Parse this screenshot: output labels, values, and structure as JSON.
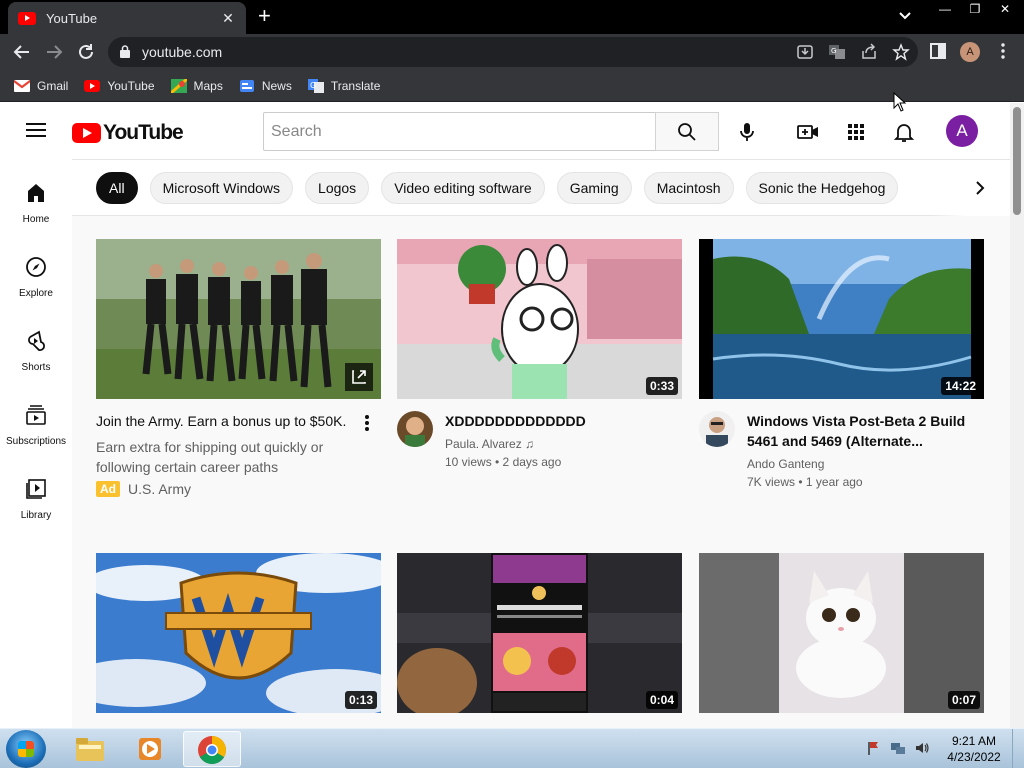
{
  "browser": {
    "tab_title": "YouTube",
    "tab_close": "✕",
    "new_tab": "+",
    "url": "youtube.com",
    "profile_initial": "A",
    "window_controls": [
      "—",
      "❐",
      "✕"
    ],
    "bookmarks": [
      {
        "label": "Gmail",
        "icon": "gmail-icon"
      },
      {
        "label": "YouTube",
        "icon": "youtube-icon"
      },
      {
        "label": "Maps",
        "icon": "maps-icon"
      },
      {
        "label": "News",
        "icon": "news-icon"
      },
      {
        "label": "Translate",
        "icon": "translate-icon"
      }
    ]
  },
  "youtube": {
    "logo_text": "YouTube",
    "search_placeholder": "Search",
    "avatar_initial": "A",
    "accent_color": "#ff0000",
    "chips": [
      "All",
      "Microsoft Windows",
      "Logos",
      "Video editing software",
      "Gaming",
      "Macintosh",
      "Sonic the Hedgehog"
    ],
    "sidebar": [
      {
        "label": "Home",
        "icon": "home-icon"
      },
      {
        "label": "Explore",
        "icon": "compass-icon"
      },
      {
        "label": "Shorts",
        "icon": "shorts-icon"
      },
      {
        "label": "Subscriptions",
        "icon": "subscriptions-icon"
      },
      {
        "label": "Library",
        "icon": "library-icon"
      }
    ],
    "ad": {
      "title": "Join the Army. Earn a bonus up to $50K.",
      "description": "Earn extra for shipping out quickly or following certain career paths",
      "badge": "Ad",
      "advertiser": "U.S. Army"
    },
    "videos": [
      {
        "title": "XDDDDDDDDDDDDD",
        "channel": "Paula. Alvarez ♫",
        "stats": "10 views • 2 days ago",
        "duration": "0:33"
      },
      {
        "title": "Windows Vista Post-Beta 2 Build 5461 and 5469 (Alternate...",
        "channel": "Ando Ganteng",
        "stats": "7K views • 1 year ago",
        "duration": "14:22"
      },
      {
        "duration": "0:13"
      },
      {
        "duration": "0:04"
      },
      {
        "duration": "0:07"
      }
    ]
  },
  "taskbar": {
    "time": "9:21 AM",
    "date": "4/23/2022"
  }
}
